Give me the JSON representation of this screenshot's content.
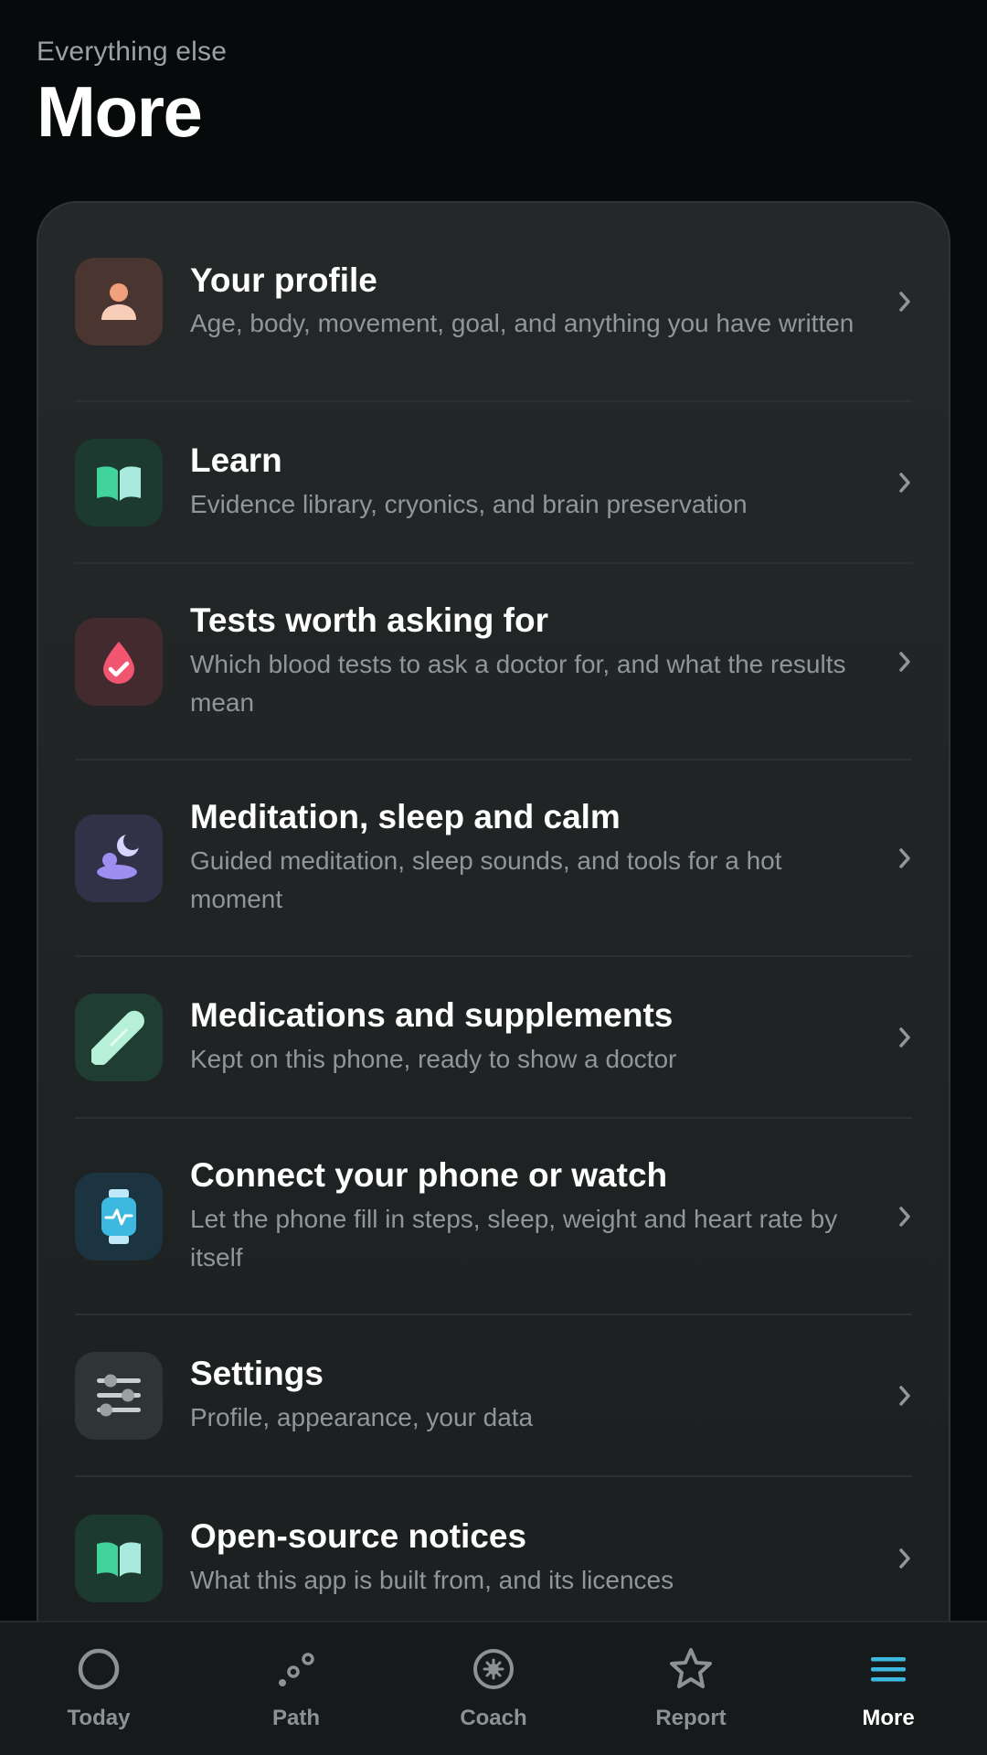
{
  "header": {
    "eyebrow": "Everything else",
    "title": "More"
  },
  "colors": {
    "background": "#060a0b",
    "card": "#1f2324",
    "accent": "#3db8e0"
  },
  "items": [
    {
      "title": "Your profile",
      "subtitle": "Age, body, movement, goal, and anything you have written",
      "icon": "person-icon"
    },
    {
      "title": "Learn",
      "subtitle": "Evidence library, cryonics, and brain preservation",
      "icon": "book-icon"
    },
    {
      "title": "Tests worth asking for",
      "subtitle": "Which blood tests to ask a doctor for, and what the results mean",
      "icon": "blood-drop-icon"
    },
    {
      "title": "Meditation, sleep and calm",
      "subtitle": "Guided meditation, sleep sounds, and tools for a hot moment",
      "icon": "meditation-moon-icon"
    },
    {
      "title": "Medications and supplements",
      "subtitle": "Kept on this phone, ready to show a doctor",
      "icon": "pill-icon"
    },
    {
      "title": "Connect your phone or watch",
      "subtitle": "Let the phone fill in steps, sleep, weight and heart rate by itself",
      "icon": "watch-icon"
    },
    {
      "title": "Settings",
      "subtitle": "Profile, appearance, your data",
      "icon": "sliders-icon"
    },
    {
      "title": "Open-source notices",
      "subtitle": "What this app is built from, and its licences",
      "icon": "book-icon"
    }
  ],
  "tabs": [
    {
      "label": "Today",
      "icon": "circle-icon",
      "active": false
    },
    {
      "label": "Path",
      "icon": "path-dots-icon",
      "active": false
    },
    {
      "label": "Coach",
      "icon": "coach-icon",
      "active": false
    },
    {
      "label": "Report",
      "icon": "star-icon",
      "active": false
    },
    {
      "label": "More",
      "icon": "menu-icon",
      "active": true
    }
  ]
}
